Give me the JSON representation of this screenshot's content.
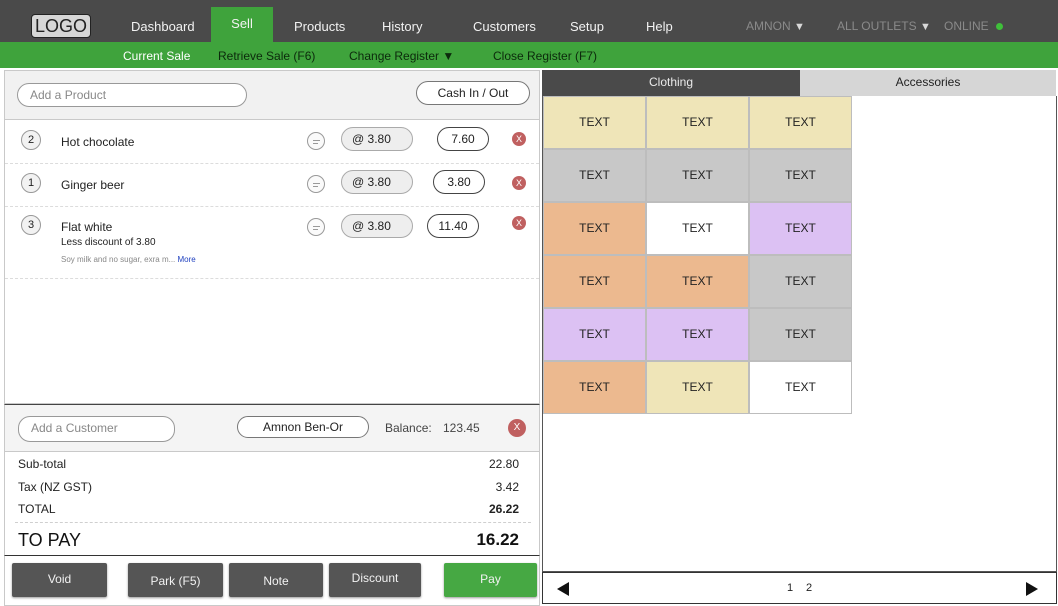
{
  "header": {
    "logo": "LOGO",
    "nav": [
      "Dashboard",
      "Sell",
      "Products",
      "History",
      "Customers",
      "Setup",
      "Help"
    ],
    "user": "AMNON",
    "outlets": "ALL OUTLETS",
    "status": "ONLINE",
    "status_color": "#3fbf3a"
  },
  "subnav": {
    "current_sale": "Current Sale",
    "retrieve_sale": "Retrieve Sale (F6)",
    "change_register": "Change Register ▼",
    "close_register": "Close Register (F7)"
  },
  "sale": {
    "add_product_placeholder": "Add a Product",
    "cash_in_out": "Cash In / Out",
    "lines": [
      {
        "qty": "2",
        "name": "Hot chocolate",
        "unit_price": "@ 3.80",
        "total": "7.60",
        "remove": "X"
      },
      {
        "qty": "1",
        "name": "Ginger beer",
        "unit_price": "@ 3.80",
        "total": "3.80",
        "remove": "X"
      },
      {
        "qty": "3",
        "name": "Flat white",
        "discount_note": "Less discount of 3.80",
        "note": "Soy milk and no sugar, exra m...",
        "note_more": "More",
        "unit_price": "@ 3.80",
        "total": "11.40",
        "remove": "X"
      }
    ]
  },
  "customer": {
    "add_customer_placeholder": "Add a Customer",
    "name": "Amnon Ben-Or",
    "balance_label": "Balance:",
    "balance_value": "123.45",
    "remove": "X"
  },
  "totals": {
    "subtotal_label": "Sub-total",
    "subtotal_value": "22.80",
    "tax_label": "Tax (NZ GST)",
    "tax_value": "3.42",
    "total_label": "TOTAL",
    "total_value": "26.22",
    "topay_label": "TO PAY",
    "topay_value": "16.22"
  },
  "actions": {
    "void": "Void",
    "park": "Park (F5)",
    "note": "Note",
    "discount": "Discount",
    "pay": "Pay"
  },
  "quick_keys": {
    "tabs": [
      "Clothing",
      "Accessories"
    ],
    "active_tab": "Clothing",
    "tiles": [
      {
        "label": "TEXT",
        "color": "#efe5b8"
      },
      {
        "label": "TEXT",
        "color": "#efe5b8"
      },
      {
        "label": "TEXT",
        "color": "#efe5b8"
      },
      {
        "label": "TEXT",
        "color": "#c8c8c8"
      },
      {
        "label": "TEXT",
        "color": "#c8c8c8"
      },
      {
        "label": "TEXT",
        "color": "#c8c8c8"
      },
      {
        "label": "TEXT",
        "color": "#ecb98f"
      },
      {
        "label": "TEXT",
        "color": "#ffffff"
      },
      {
        "label": "TEXT",
        "color": "#dcc1f3"
      },
      {
        "label": "TEXT",
        "color": "#ecb98f"
      },
      {
        "label": "TEXT",
        "color": "#ecb98f"
      },
      {
        "label": "TEXT",
        "color": "#c8c8c8"
      },
      {
        "label": "TEXT",
        "color": "#dcc1f3"
      },
      {
        "label": "TEXT",
        "color": "#dcc1f3"
      },
      {
        "label": "TEXT",
        "color": "#c8c8c8"
      },
      {
        "label": "TEXT",
        "color": "#ecb98f"
      },
      {
        "label": "TEXT",
        "color": "#efe5b8"
      },
      {
        "label": "TEXT",
        "color": "#ffffff"
      }
    ],
    "pages": [
      "1",
      "2"
    ]
  },
  "colors": {
    "nav_bg": "#4a4a4a",
    "accent_green": "#3fa33c",
    "remove_red": "#c06060"
  }
}
